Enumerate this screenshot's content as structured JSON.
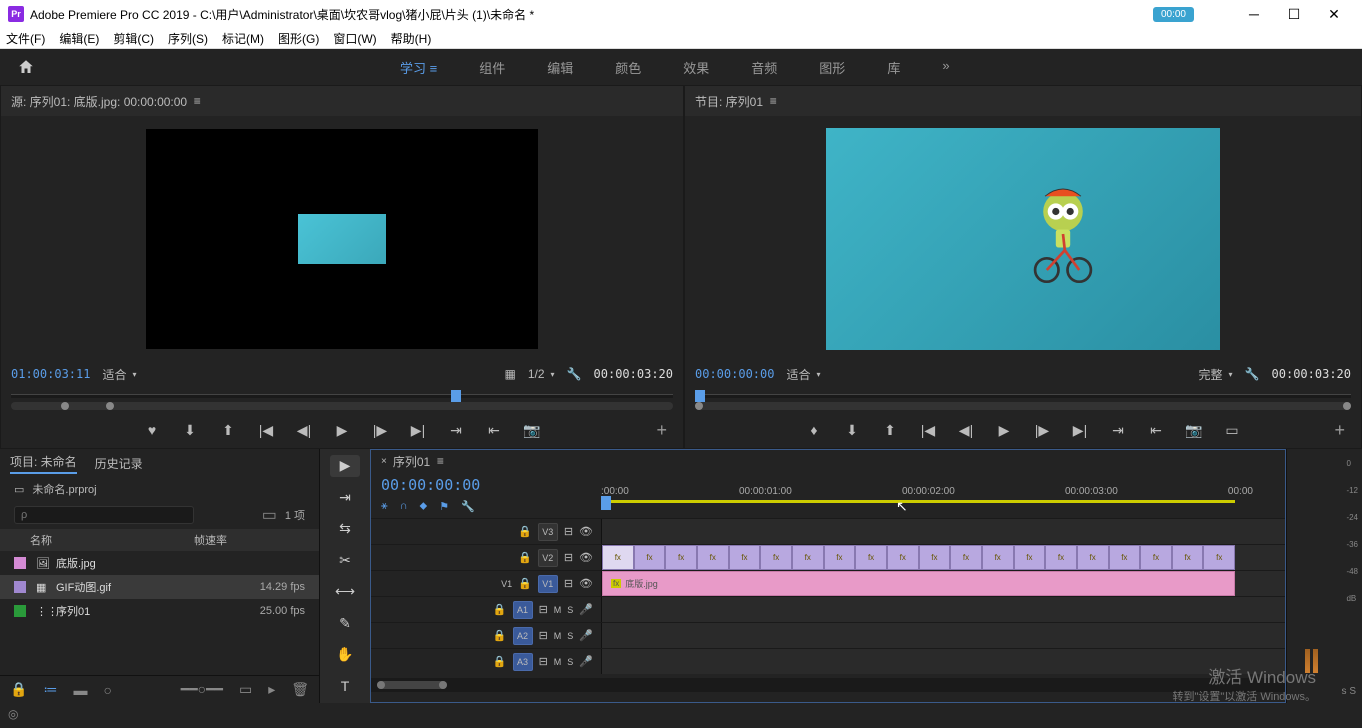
{
  "titlebar": {
    "app": "Adobe Premiere Pro CC 2019",
    "path": "C:\\用户\\Administrator\\桌面\\坎农哥vlog\\猪小屁\\片头 (1)\\未命名 *",
    "badge": "00:00"
  },
  "menu": [
    "文件(F)",
    "编辑(E)",
    "剪辑(C)",
    "序列(S)",
    "标记(M)",
    "图形(G)",
    "窗口(W)",
    "帮助(H)"
  ],
  "workspaces": {
    "items": [
      "学习",
      "组件",
      "编辑",
      "颜色",
      "效果",
      "音频",
      "图形",
      "库"
    ],
    "active": 0
  },
  "source": {
    "header": "源: 序列01: 底版.jpg: 00:00:00:00",
    "tc_left": "01:00:03:11",
    "fit": "适合",
    "half": "1/2",
    "tc_right": "00:00:03:20"
  },
  "program": {
    "header": "节目: 序列01",
    "tc_left": "00:00:00:00",
    "fit": "适合",
    "full": "完整",
    "tc_right": "00:00:03:20"
  },
  "project": {
    "tabs": [
      "项目: 未命名",
      "历史记录"
    ],
    "file": "未命名.prproj",
    "count": "1 项",
    "cols": {
      "name": "名称",
      "rate": "帧速率"
    },
    "items": [
      {
        "swatch": "#d48ad4",
        "icon": "🖼",
        "name": "底版.jpg",
        "rate": ""
      },
      {
        "swatch": "#a088d0",
        "icon": "▦",
        "name": "GIF动图.gif",
        "rate": "14.29 fps",
        "selected": true
      },
      {
        "swatch": "#2a9a3a",
        "icon": "⋮⋮",
        "name": "序列01",
        "rate": "25.00 fps"
      }
    ],
    "search_ph": "ρ"
  },
  "timeline": {
    "tab": "序列01",
    "tc": "00:00:00:00",
    "ruler": [
      ":00:00",
      "00:00:01:00",
      "00:00:02:00",
      "00:00:03:00",
      "00:00"
    ],
    "tracks": {
      "v3": "V3",
      "v2": "V2",
      "v1": "V1",
      "a1": "A1",
      "a2": "A2",
      "a3": "A3"
    },
    "fx": "fx",
    "clip1": "底版.jpg",
    "m": "M",
    "s": "S"
  },
  "meters": {
    "labels": [
      "0",
      "-12",
      "-24",
      "-36",
      "-48",
      "dB"
    ],
    "footer": "s    S"
  },
  "watermark": {
    "title": "激活 Windows",
    "sub": "转到\"设置\"以激活 Windows。"
  }
}
